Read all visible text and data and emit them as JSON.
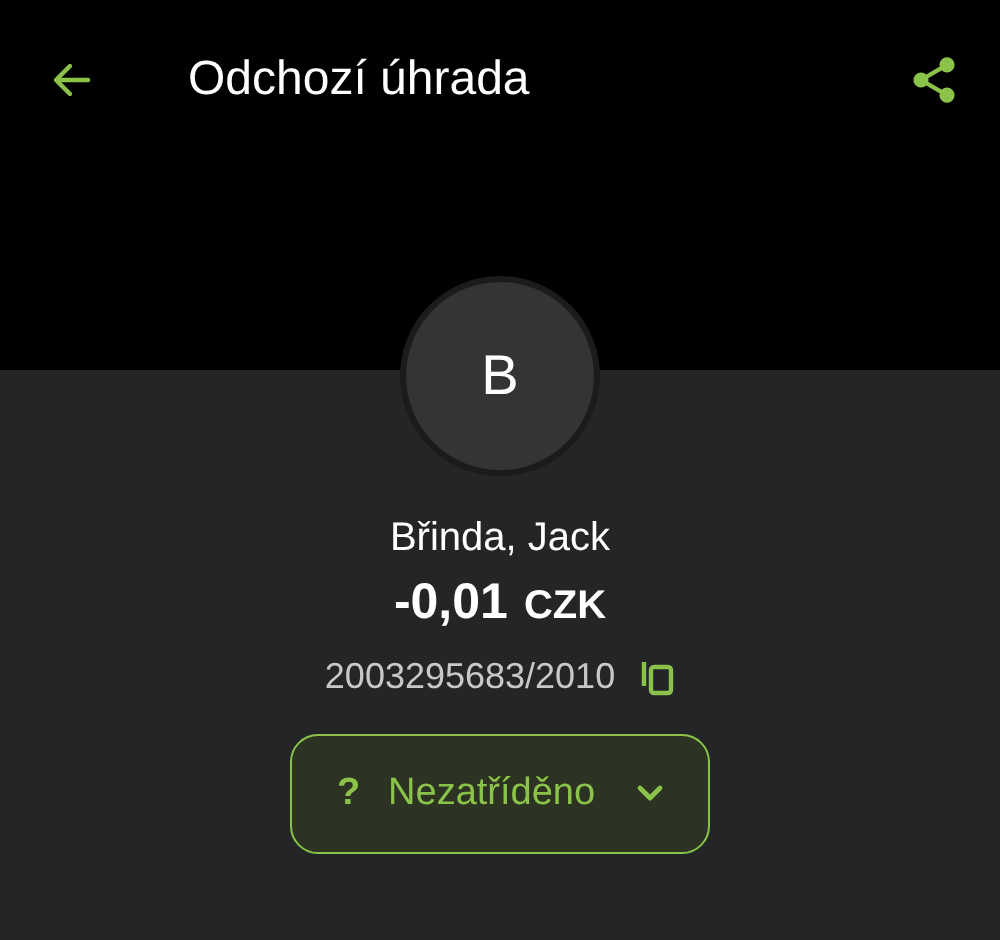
{
  "header": {
    "title": "Odchozí úhrada"
  },
  "avatar": {
    "initial": "B"
  },
  "counterparty": {
    "name": "Břinda, Jack"
  },
  "amount": {
    "value": "-0,01",
    "currency": "CZK"
  },
  "account": {
    "number": "2003295683/2010"
  },
  "category": {
    "symbol": "?",
    "label": "Nezatříděno"
  }
}
